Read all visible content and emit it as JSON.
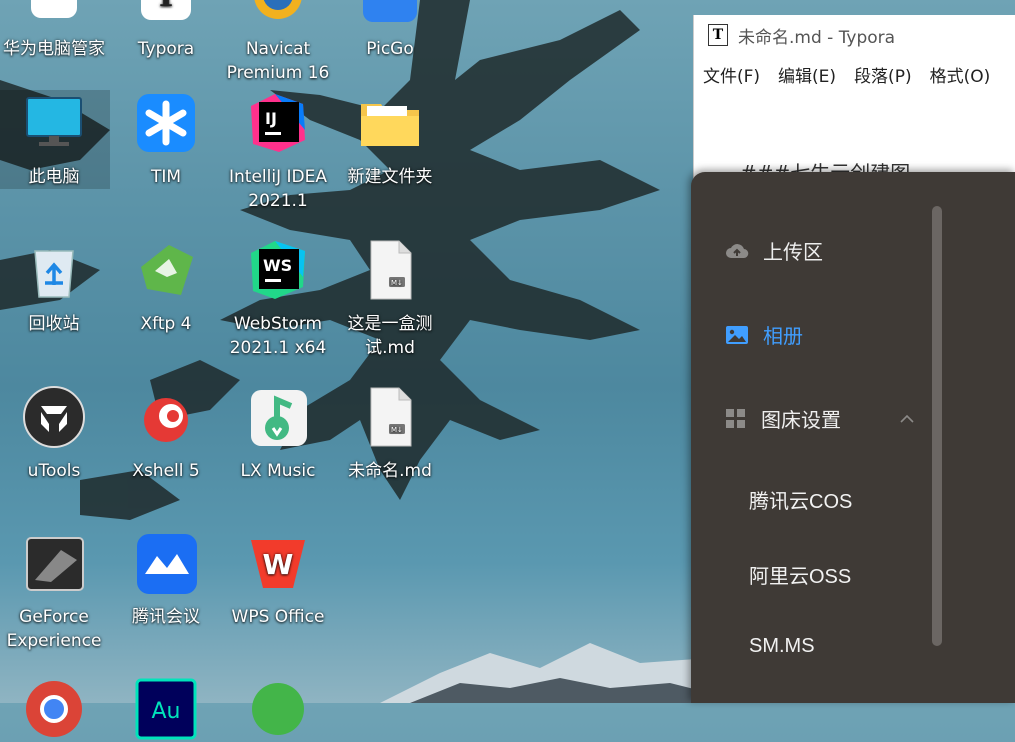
{
  "desktop": {
    "icons": [
      {
        "label": "华为电脑管家",
        "name": "huawei-pc-manager-icon"
      },
      {
        "label": "Typora",
        "name": "typora-icon"
      },
      {
        "label": "Navicat Premium 16",
        "name": "navicat-icon"
      },
      {
        "label": "PicGo",
        "name": "picgo-icon"
      },
      {
        "label": "此电脑",
        "name": "this-pc-icon"
      },
      {
        "label": "TIM",
        "name": "tim-icon"
      },
      {
        "label": "IntelliJ IDEA 2021.1",
        "name": "intellij-idea-icon"
      },
      {
        "label": "新建文件夹",
        "name": "new-folder-icon"
      },
      {
        "label": "回收站",
        "name": "recycle-bin-icon"
      },
      {
        "label": "Xftp 4",
        "name": "xftp-icon"
      },
      {
        "label": "WebStorm 2021.1 x64",
        "name": "webstorm-icon"
      },
      {
        "label": "这是一盒测试.md",
        "name": "markdown-file-icon"
      },
      {
        "label": "uTools",
        "name": "utools-icon"
      },
      {
        "label": "Xshell 5",
        "name": "xshell-icon"
      },
      {
        "label": "LX Music",
        "name": "lx-music-icon"
      },
      {
        "label": "未命名.md",
        "name": "markdown-file-icon"
      },
      {
        "label": "GeForce Experience",
        "name": "geforce-icon"
      },
      {
        "label": "腾讯会议",
        "name": "tencent-meeting-icon"
      },
      {
        "label": "WPS Office",
        "name": "wps-office-icon"
      }
    ]
  },
  "typora": {
    "title": "未命名.md - Typora",
    "logo": "T",
    "menu": [
      "文件(F)",
      "编辑(E)",
      "段落(P)",
      "格式(O)"
    ],
    "content": "###七牛云创建图"
  },
  "picgo": {
    "nav": {
      "upload": "上传区",
      "album": "相册",
      "settings": "图床设置"
    },
    "subitems": [
      "腾讯云COS",
      "阿里云OSS",
      "SM.MS"
    ],
    "colors": {
      "active": "#409eff",
      "panel_bg": "#3f3a36"
    }
  }
}
